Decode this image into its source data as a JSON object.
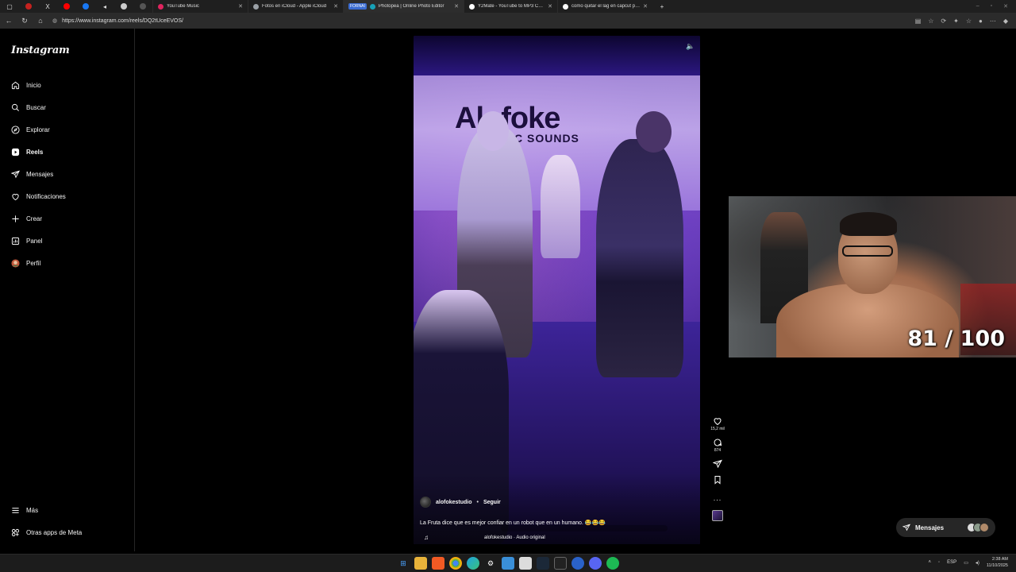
{
  "browser": {
    "tabs": [
      {
        "title": "YouTube Music",
        "color": "#e0245e"
      },
      {
        "title": "Fotos en iCloud - Apple iCloud",
        "color": "#9aa0a6"
      },
      {
        "badge": "FORNAI",
        "title": "Photopea | Online Photo Editor",
        "color": "#17a2b8"
      },
      {
        "title": "Y2Mate - YouTube to MP3 Conve...",
        "color": "#ffffff"
      },
      {
        "title": "como quitar el lag en capcut pc -",
        "color": "#ffffff"
      }
    ],
    "url": "https://www.instagram.com/reels/DQ2tUceEVOS/"
  },
  "sidebar": {
    "logo": "Instagram",
    "items": [
      {
        "label": "Inicio",
        "icon": "home-icon"
      },
      {
        "label": "Buscar",
        "icon": "search-icon"
      },
      {
        "label": "Explorar",
        "icon": "compass-icon"
      },
      {
        "label": "Reels",
        "icon": "reels-icon",
        "active": true
      },
      {
        "label": "Mensajes",
        "icon": "send-icon"
      },
      {
        "label": "Notificaciones",
        "icon": "heart-icon"
      },
      {
        "label": "Crear",
        "icon": "plus-icon"
      },
      {
        "label": "Panel",
        "icon": "chart-icon"
      },
      {
        "label": "Perfil",
        "icon": "profile-avatar"
      }
    ],
    "bottom": [
      {
        "label": "Más",
        "icon": "menu-icon"
      },
      {
        "label": "Otras apps de Meta",
        "icon": "meta-apps-icon"
      }
    ]
  },
  "reel": {
    "brand": "Alofoke",
    "brand_sub": "MUSIC SOUNDS",
    "author": "alofokestudio",
    "separator": "•",
    "follow_label": "Seguir",
    "caption": "La Fruta dice que es mejor confiar en un robot que en un humano. 😂😂😂",
    "audio": "alofokestudio · Audio original",
    "likes": "15,2 mil",
    "comments": "874",
    "more": "..."
  },
  "webcam": {
    "counter": "81 / 100"
  },
  "messages": {
    "label": "Mensajes"
  },
  "taskbar": {
    "lang": "ESP",
    "time": "2:38 AM",
    "date": "11/10/2025"
  },
  "colors": {
    "background": "#000000",
    "sidebar_border": "#262626",
    "reel_purple": "#6b3fb5",
    "accent_blue": "#3a6bd1"
  }
}
